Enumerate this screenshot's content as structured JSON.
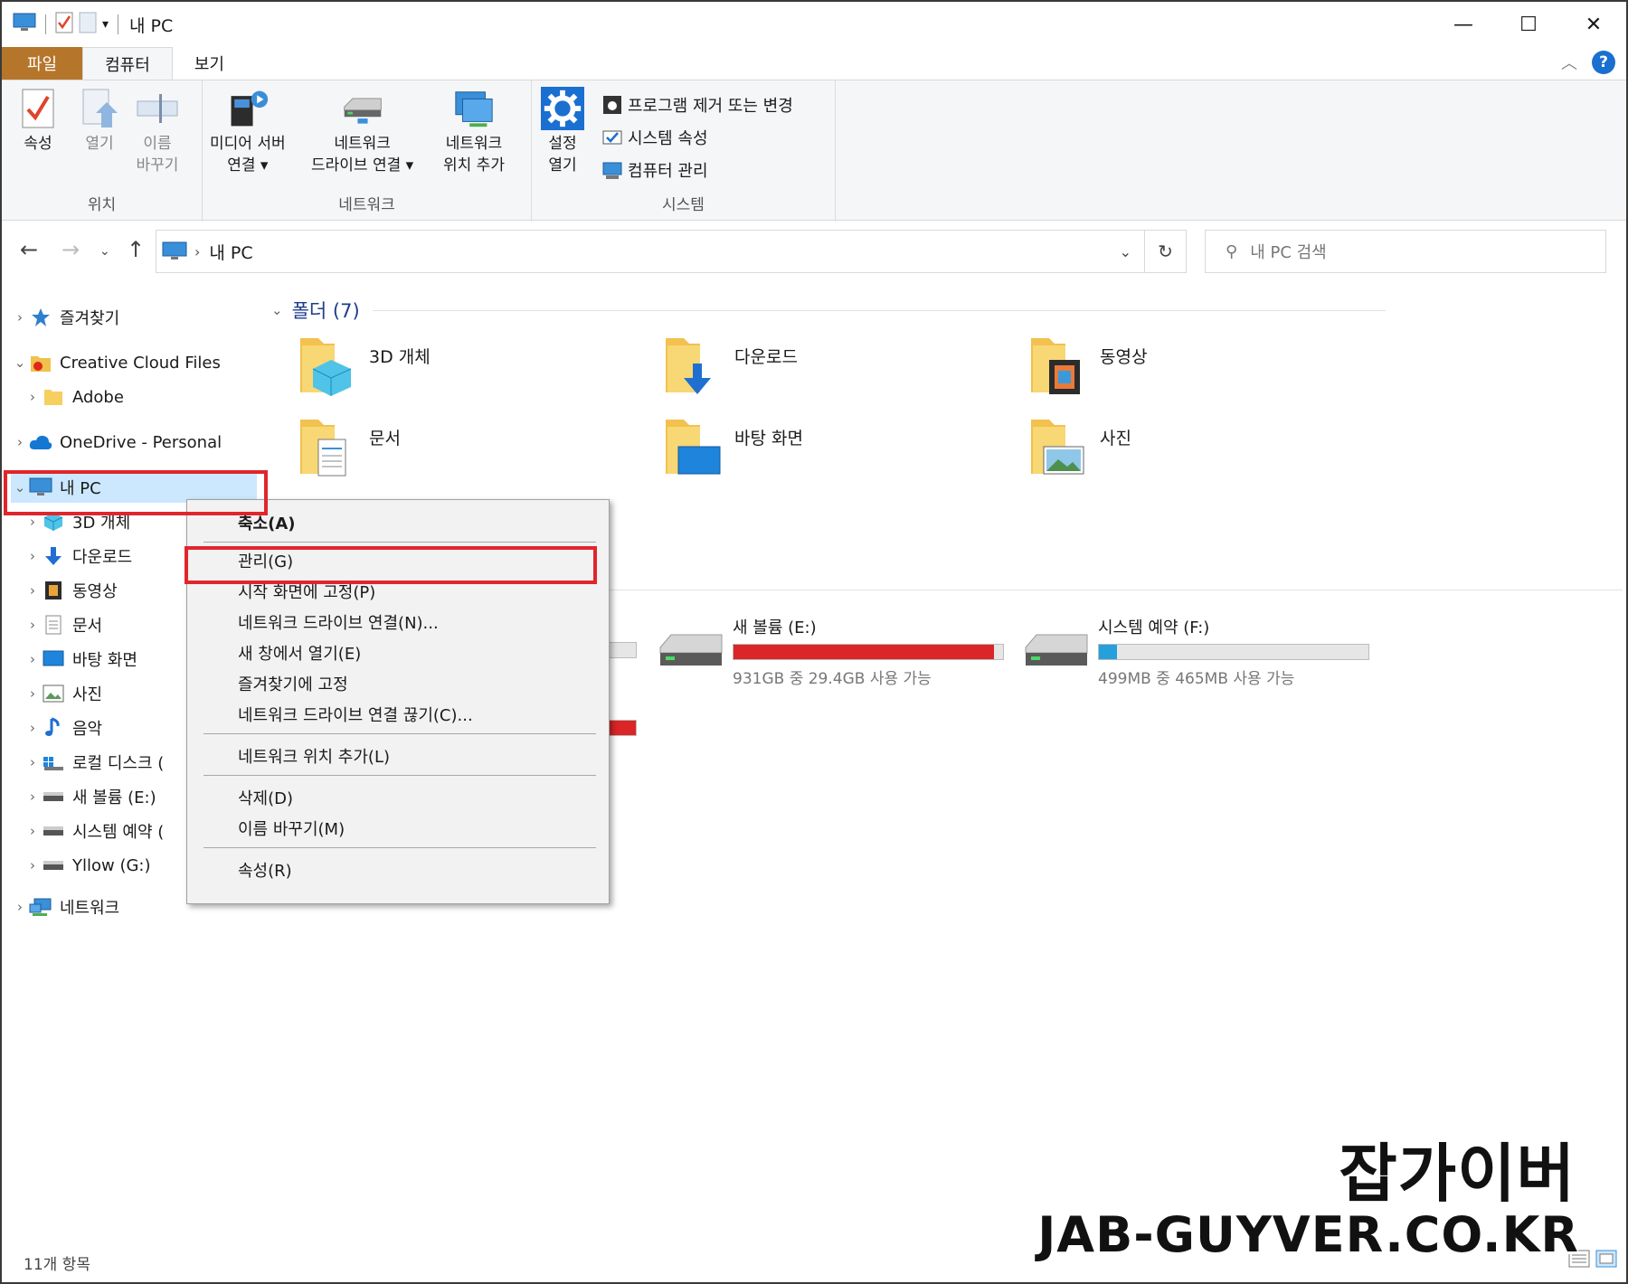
{
  "window": {
    "title": "내 PC",
    "controls": {
      "minimize": "—",
      "maximize": "☐",
      "close": "✕"
    }
  },
  "ribbon_tabs": [
    {
      "label": "파일"
    },
    {
      "label": "컴퓨터"
    },
    {
      "label": "보기"
    }
  ],
  "ribbon": {
    "location": {
      "label": "위치",
      "properties": [
        "속성"
      ],
      "open": [
        "열기"
      ],
      "rename": [
        "이름",
        "바꾸기"
      ]
    },
    "network": {
      "label": "네트워크",
      "media_server": [
        "미디어 서버",
        "연결 ▾"
      ],
      "map_drive": [
        "네트워크",
        "드라이브 연결 ▾"
      ],
      "add_location": [
        "네트워크",
        "위치 추가"
      ]
    },
    "system": {
      "label": "시스템",
      "settings": [
        "설정",
        "열기"
      ],
      "uninstall": "프로그램 제거 또는 변경",
      "sys_props": "시스템 속성",
      "manage": "컴퓨터 관리"
    }
  },
  "address": {
    "path": "내 PC",
    "search_placeholder": "내 PC 검색"
  },
  "nav_tree": {
    "favorites": "즐겨찾기",
    "creative_cloud": "Creative Cloud Files",
    "adobe": "Adobe",
    "onedrive": "OneDrive - Personal",
    "mypc": "내 PC",
    "children": [
      "3D 개체",
      "다운로드",
      "동영상",
      "문서",
      "바탕 화면",
      "사진",
      "음악",
      "로컬 디스크 (",
      "새 볼륨 (E:)",
      "시스템 예약 (",
      "Yllow (G:)"
    ],
    "network": "네트워크"
  },
  "folders_section": "폴더 (7)",
  "folders": [
    "3D 개체",
    "다운로드",
    "동영상",
    "문서",
    "바탕 화면",
    "사진"
  ],
  "drives": [
    {
      "name": "새 볼륨 (E:)",
      "info": "931GB 중 29.4GB 사용 가능",
      "used_fraction": 0.968,
      "color": "#da2626"
    },
    {
      "name": "시스템 예약 (F:)",
      "info": "499MB 중 465MB 사용 가능",
      "used_fraction": 0.068,
      "color": "#26a0da"
    }
  ],
  "context_menu": {
    "items": [
      "축소(A)",
      "관리(G)",
      "시작 화면에 고정(P)",
      "네트워크 드라이브 연결(N)...",
      "새 창에서 열기(E)",
      "즐겨찾기에 고정",
      "네트워크 드라이브 연결 끊기(C)...",
      "네트워크 위치 추가(L)",
      "삭제(D)",
      "이름 바꾸기(M)",
      "속성(R)"
    ]
  },
  "status": {
    "count": "11개 항목"
  },
  "watermark": {
    "line1": "잡가이버",
    "line2": "JAB-GUYVER.CO.KR"
  },
  "colors": {
    "accent_file_tab": "#b5752a",
    "selection": "#cce8ff",
    "highlight": "#e0262b",
    "drive_full": "#da2626",
    "drive_ok": "#26a0da"
  }
}
